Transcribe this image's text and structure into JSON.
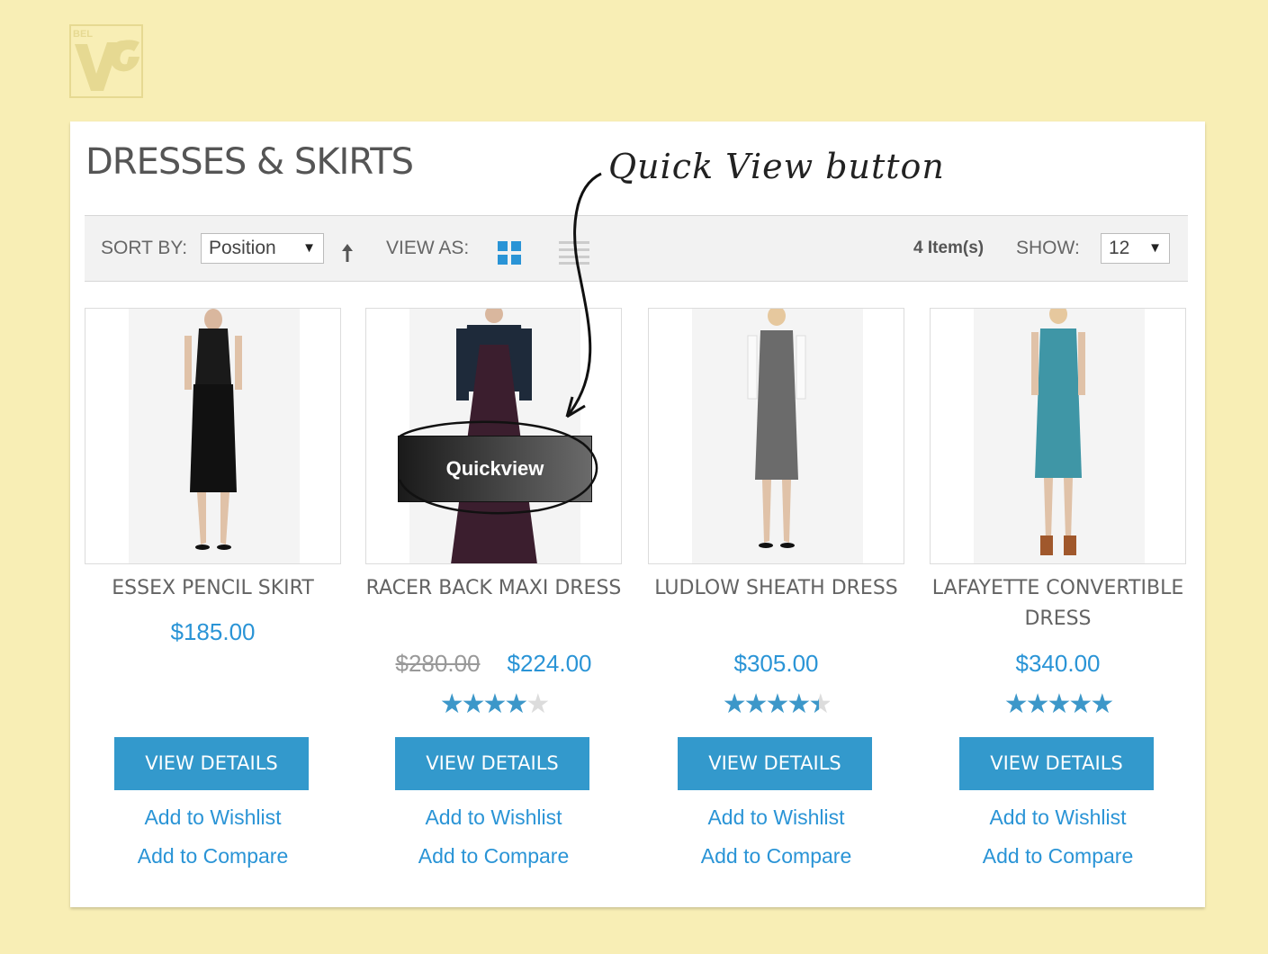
{
  "logo": {
    "text": "BEL",
    "icon": "belvg-logo-icon"
  },
  "page_title": "DRESSES & SKIRTS",
  "annotation": "Quick View button",
  "toolbar": {
    "sort_label": "SORT BY:",
    "sort_value": "Position",
    "view_label": "VIEW AS:",
    "item_count": "4 Item(s)",
    "show_label": "SHOW:",
    "show_value": "12"
  },
  "quickview_label": "Quickview",
  "accent_color": "#3399cc",
  "products": [
    {
      "name": "ESSEX PENCIL SKIRT",
      "price": "$185.00",
      "old_price": "",
      "rating": 0,
      "button": "VIEW DETAILS",
      "wishlist": "Add to Wishlist",
      "compare": "Add to Compare"
    },
    {
      "name": "RACER BACK MAXI DRESS",
      "price": "$224.00",
      "old_price": "$280.00",
      "rating": 4,
      "button": "VIEW DETAILS",
      "wishlist": "Add to Wishlist",
      "compare": "Add to Compare"
    },
    {
      "name": "LUDLOW SHEATH DRESS",
      "price": "$305.00",
      "old_price": "",
      "rating": 4.5,
      "button": "VIEW DETAILS",
      "wishlist": "Add to Wishlist",
      "compare": "Add to Compare"
    },
    {
      "name": "LAFAYETTE CONVERTIBLE DRESS",
      "price": "$340.00",
      "old_price": "",
      "rating": 5,
      "button": "VIEW DETAILS",
      "wishlist": "Add to Wishlist",
      "compare": "Add to Compare"
    }
  ]
}
